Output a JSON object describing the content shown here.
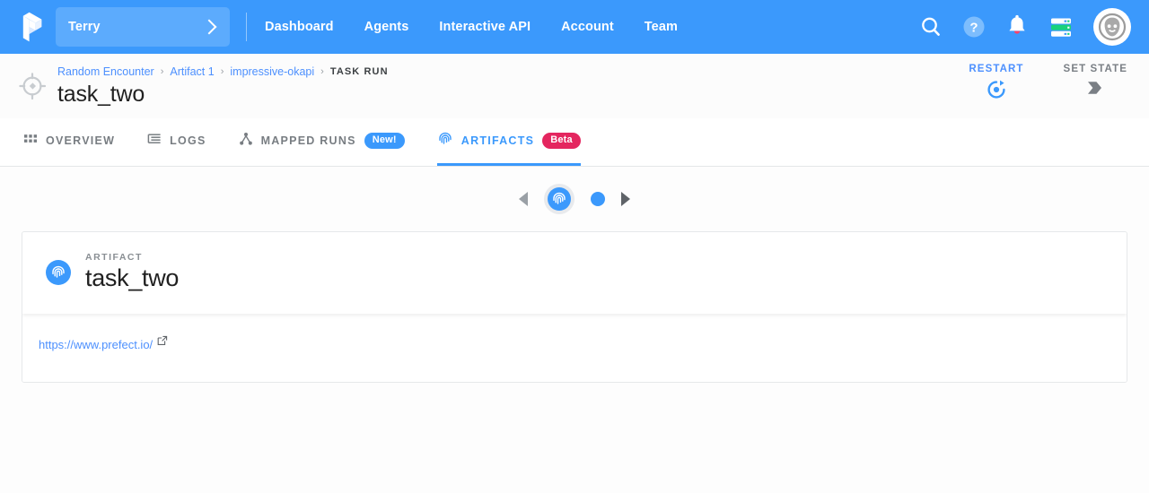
{
  "topnav": {
    "logo_icon": "prefect-logo-icon",
    "team_switcher": {
      "name": "Terry",
      "chevron_icon": "chevron-right-icon"
    },
    "links": [
      {
        "label": "Dashboard",
        "name": "dashboard"
      },
      {
        "label": "Agents",
        "name": "agents"
      },
      {
        "label": "Interactive API",
        "name": "interactive-api"
      },
      {
        "label": "Account",
        "name": "account"
      },
      {
        "label": "Team",
        "name": "team"
      }
    ],
    "icons": [
      {
        "name": "search-icon"
      },
      {
        "name": "help-icon"
      },
      {
        "name": "notifications-bell-icon"
      },
      {
        "name": "server-status-icon"
      },
      {
        "name": "user-avatar-icon"
      }
    ]
  },
  "subheader": {
    "run_state_icon": "task-run-state-icon",
    "breadcrumb": [
      {
        "label": "Random Encounter",
        "type": "link"
      },
      {
        "label": "Artifact 1",
        "type": "link"
      },
      {
        "label": "impressive-okapi",
        "type": "link"
      },
      {
        "label": "TASK RUN",
        "type": "current"
      }
    ],
    "separator": "›",
    "title": "task_two",
    "actions": [
      {
        "label": "RESTART",
        "icon": "restart-icon",
        "name": "restart"
      },
      {
        "label": "SET STATE",
        "icon": "set-state-icon",
        "name": "set-state"
      }
    ]
  },
  "tabs": [
    {
      "label": "OVERVIEW",
      "icon": "grid-icon",
      "name": "overview",
      "active": false,
      "badge": null
    },
    {
      "label": "LOGS",
      "icon": "logs-lines-icon",
      "name": "logs",
      "active": false,
      "badge": null
    },
    {
      "label": "MAPPED RUNS",
      "icon": "mapped-runs-node-icon",
      "name": "mapped-runs",
      "active": false,
      "badge": "New!"
    },
    {
      "label": "ARTIFACTS",
      "icon": "fingerprint-icon",
      "name": "artifacts",
      "active": true,
      "badge": "Beta"
    }
  ],
  "carousel": {
    "prev_icon": "carousel-prev-arrow-icon",
    "next_icon": "carousel-next-arrow-icon",
    "active_icon": "fingerprint-icon",
    "dots": 2,
    "active_index": 0
  },
  "artifact": {
    "kicker": "ARTIFACT",
    "name": "task_two",
    "icon": "fingerprint-icon",
    "link": {
      "text": "https://www.prefect.io/",
      "external_icon": "external-link-icon"
    }
  },
  "colors": {
    "brand_blue": "#3b99fc",
    "link_blue": "#4d90fe",
    "beta_pink": "#e4265f",
    "text_dark": "#212121",
    "text_muted": "#787d82",
    "page_bg": "#fdfdfd"
  }
}
